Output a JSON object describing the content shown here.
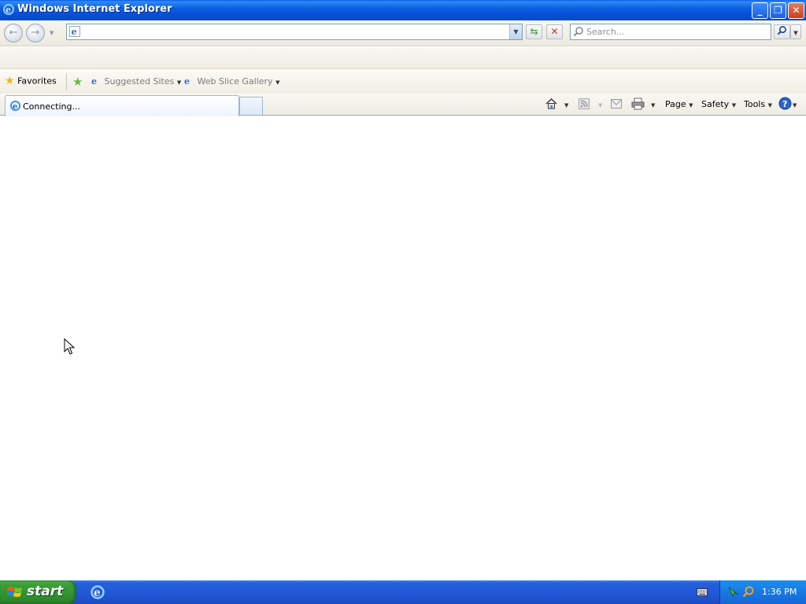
{
  "window": {
    "title": "Windows Internet Explorer"
  },
  "window_controls": {
    "minimize": "_",
    "restore": "❐",
    "close": "✕"
  },
  "address_bar": {
    "value": ""
  },
  "search": {
    "placeholder": "Search..."
  },
  "favorites_bar": {
    "favorites_label": "Favorites",
    "items": [
      {
        "label": "Suggested Sites"
      },
      {
        "label": "Web Slice Gallery"
      }
    ]
  },
  "tabs": [
    {
      "label": "Connecting..."
    }
  ],
  "command_bar": {
    "page_label": "Page",
    "safety_label": "Safety",
    "tools_label": "Tools"
  },
  "taskbar": {
    "start_label": "start",
    "clock": "1:36 PM"
  },
  "colors": {
    "titlebar": "#0a5ae8",
    "taskbar": "#245edb",
    "start_button": "#3a9e3a",
    "tray": "#1565d6"
  },
  "icons": [
    "ie-icon",
    "back-icon",
    "forward-icon",
    "refresh-icon",
    "stop-icon",
    "search-icon",
    "star-icon",
    "home-icon",
    "feed-icon",
    "mail-icon",
    "print-icon",
    "help-icon",
    "windows-logo-icon",
    "keyboard-icon"
  ]
}
